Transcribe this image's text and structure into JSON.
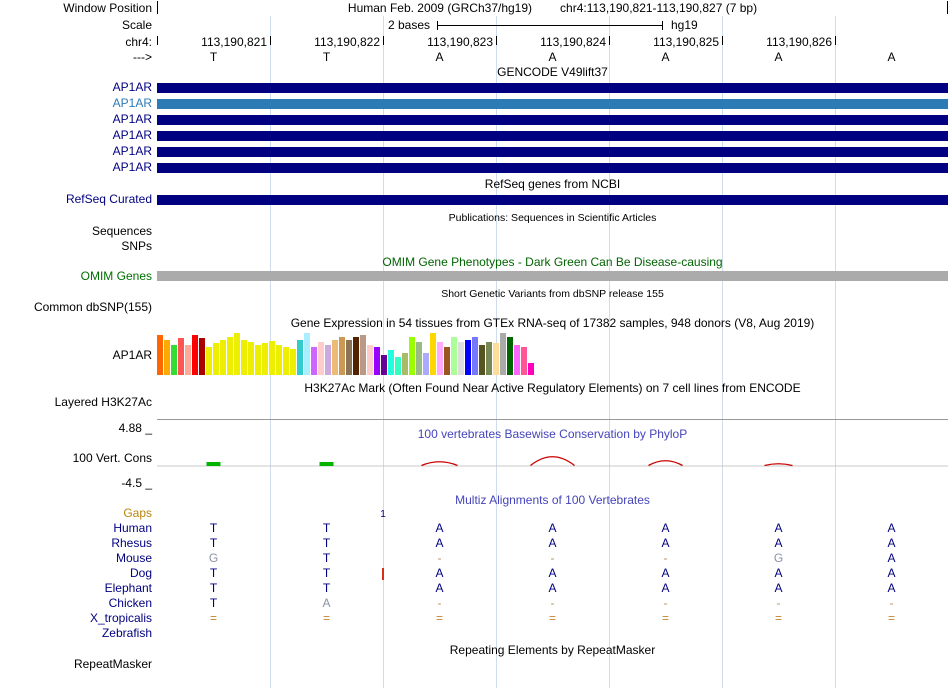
{
  "window": {
    "label": "Window Position",
    "assembly_title": "Human Feb. 2009 (GRCh37/hg19)",
    "position": "chr4:113,190,821-113,190,827 (7 bp)"
  },
  "scale": {
    "label": "Scale",
    "bar_label": "2 bases",
    "assembly": "hg19"
  },
  "ruler": {
    "chrom_label": "chr4:",
    "coordinates": [
      "113,190,821",
      "113,190,822",
      "113,190,823",
      "113,190,824",
      "113,190,825",
      "113,190,826"
    ]
  },
  "sequence": {
    "label": "--->",
    "bases": [
      "T",
      "T",
      "A",
      "A",
      "A",
      "A",
      "A"
    ]
  },
  "gencode": {
    "header": "GENCODE V49lift37",
    "transcripts": [
      {
        "label": "AP1AR",
        "color": "#000080"
      },
      {
        "label": "AP1AR",
        "color": "#2d7bb5"
      },
      {
        "label": "AP1AR",
        "color": "#000080"
      },
      {
        "label": "AP1AR",
        "color": "#000080"
      },
      {
        "label": "AP1AR",
        "color": "#000080"
      },
      {
        "label": "AP1AR",
        "color": "#000080"
      }
    ]
  },
  "refseq": {
    "header": "RefSeq genes from NCBI",
    "label": "RefSeq Curated",
    "color": "#000080"
  },
  "publications": {
    "header": "Publications: Sequences in Scientific Articles"
  },
  "sequences": {
    "label": "Sequences"
  },
  "snps": {
    "label": "SNPs"
  },
  "omim": {
    "header": "OMIM Gene Phenotypes - Dark Green Can Be Disease-causing",
    "label": "OMIM Genes",
    "bar_color": "#ababab"
  },
  "dbsnp": {
    "header": "Short Genetic Variants from dbSNP release 155",
    "label": "Common dbSNP(155)"
  },
  "gtex": {
    "header": "Gene Expression in 54 tissues from GTEx RNA-seq of 17382 samples, 948 donors (V8, Aug 2019)",
    "label": "AP1AR",
    "bars": [
      [
        "#FF6600",
        40
      ],
      [
        "#FFAA00",
        35
      ],
      [
        "#33DD33",
        30
      ],
      [
        "#FF5555",
        37
      ],
      [
        "#FFAA99",
        30
      ],
      [
        "#FF0000",
        40
      ],
      [
        "#AA0000",
        37
      ],
      [
        "#EEEE00",
        28
      ],
      [
        "#EEEE00",
        32
      ],
      [
        "#EEEE00",
        35
      ],
      [
        "#EEEE00",
        38
      ],
      [
        "#EEEE00",
        42
      ],
      [
        "#EEEE00",
        35
      ],
      [
        "#EEEE00",
        33
      ],
      [
        "#EEEE00",
        30
      ],
      [
        "#EEEE00",
        32
      ],
      [
        "#EEEE00",
        34
      ],
      [
        "#EEEE00",
        30
      ],
      [
        "#EEEE00",
        28
      ],
      [
        "#EEEE00",
        26
      ],
      [
        "#33CCCC",
        35
      ],
      [
        "#AAEEFF",
        42
      ],
      [
        "#CC66FF",
        28
      ],
      [
        "#FFCCCC",
        33
      ],
      [
        "#CCAADD",
        30
      ],
      [
        "#EEBB77",
        35
      ],
      [
        "#CC9955",
        38
      ],
      [
        "#8B7355",
        35
      ],
      [
        "#552200",
        38
      ],
      [
        "#BB9988",
        40
      ],
      [
        "#FFCCCC",
        30
      ],
      [
        "#9900FF",
        28
      ],
      [
        "#660099",
        20
      ],
      [
        "#22FFDD",
        25
      ],
      [
        "#33FFC2",
        18
      ],
      [
        "#AABB66",
        22
      ],
      [
        "#99FF00",
        38
      ],
      [
        "#99BB88",
        33
      ],
      [
        "#AAAAFF",
        22
      ],
      [
        "#FFD700",
        42
      ],
      [
        "#FFAAFF",
        33
      ],
      [
        "#995522",
        28
      ],
      [
        "#AAFF99",
        38
      ],
      [
        "#DDDDDD",
        33
      ],
      [
        "#0000FF",
        35
      ],
      [
        "#7777FF",
        38
      ],
      [
        "#555522",
        30
      ],
      [
        "#778855",
        33
      ],
      [
        "#FFDD99",
        32
      ],
      [
        "#AAAAAA",
        42
      ],
      [
        "#006600",
        38
      ],
      [
        "#FF66FF",
        30
      ],
      [
        "#FF5599",
        28
      ],
      [
        "#FF00BB",
        12
      ]
    ]
  },
  "h3k27ac": {
    "header": "H3K27Ac Mark (Often Found Near Active Regulatory Elements) on 7 cell lines from ENCODE",
    "label": "Layered H3K27Ac"
  },
  "phylop": {
    "header": "100 vertebrates Basewise Conservation by PhyloP",
    "label": "100 Vert. Cons",
    "max": "4.88 _",
    "min": "-4.5 _",
    "positive_color": "#00b400",
    "negative_color": "#cc0000",
    "positive_bases": [
      0,
      1
    ],
    "negative_arcs": [
      {
        "base": 2,
        "peak": 4,
        "hw": 18
      },
      {
        "base": 3,
        "peak": 9,
        "hw": 22
      },
      {
        "base": 4,
        "peak": 5,
        "hw": 17
      },
      {
        "base": 5,
        "peak": 2,
        "hw": 14
      }
    ]
  },
  "multiz": {
    "header": "Multiz Alignments of 100 Vertebrates",
    "gaps_label": "Gaps",
    "gap_count": "1",
    "rows": [
      {
        "name": "Human",
        "seq": [
          "T",
          "T",
          "A",
          "A",
          "A",
          "A",
          "A"
        ],
        "types": [
          "n",
          "n",
          "n",
          "n",
          "n",
          "n",
          "n"
        ]
      },
      {
        "name": "Rhesus",
        "seq": [
          "T",
          "T",
          "A",
          "A",
          "A",
          "A",
          "A"
        ],
        "types": [
          "n",
          "n",
          "n",
          "n",
          "n",
          "n",
          "n"
        ]
      },
      {
        "name": "Mouse",
        "seq": [
          "G",
          "T",
          "-",
          "-",
          "-",
          "G",
          "A"
        ],
        "types": [
          "m",
          "n",
          "g",
          "g",
          "g",
          "m",
          "n"
        ]
      },
      {
        "name": "Dog",
        "seq": [
          "T",
          "T",
          "A",
          "A",
          "A",
          "A",
          "A"
        ],
        "types": [
          "n",
          "n",
          "n",
          "n",
          "n",
          "n",
          "n"
        ]
      },
      {
        "name": "Elephant",
        "seq": [
          "T",
          "T",
          "A",
          "A",
          "A",
          "A",
          "A"
        ],
        "types": [
          "n",
          "n",
          "n",
          "n",
          "n",
          "n",
          "n"
        ]
      },
      {
        "name": "Chicken",
        "seq": [
          "T",
          "A",
          "-",
          "-",
          "-",
          "-",
          "-"
        ],
        "types": [
          "n",
          "m",
          "g",
          "g",
          "g",
          "g",
          "g"
        ]
      },
      {
        "name": "X_tropicalis",
        "seq": [
          "=",
          "=",
          "=",
          "=",
          "=",
          "=",
          "="
        ],
        "types": [
          "u",
          "u",
          "u",
          "u",
          "u",
          "u",
          "u"
        ]
      },
      {
        "name": "Zebrafish",
        "seq": [
          "",
          "",
          "",
          "",
          "",
          "",
          ""
        ],
        "types": [
          "e",
          "e",
          "e",
          "e",
          "e",
          "e",
          "e"
        ]
      }
    ]
  },
  "repeatmasker": {
    "header": "Repeating Elements by RepeatMasker",
    "label": "RepeatMasker"
  }
}
